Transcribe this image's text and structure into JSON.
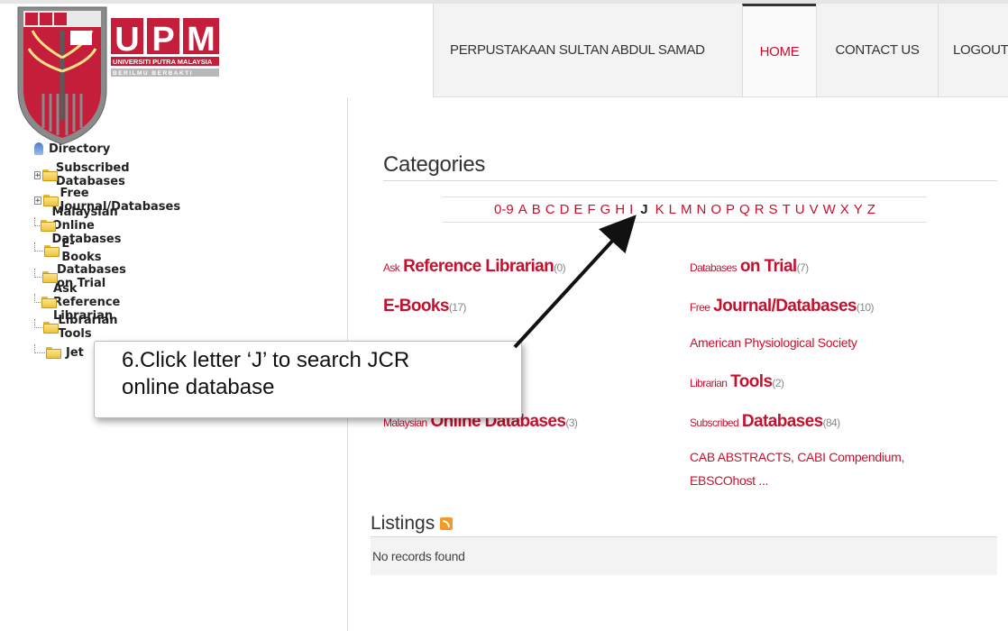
{
  "header": {
    "logo": {
      "letters": "UPM",
      "university": "UNIVERSITI PUTRA MALAYSIA",
      "motto": "BERILMU BERBAKTI"
    },
    "nav": [
      {
        "label": "PERPUSTAKAAN SULTAN ABDUL SAMAD",
        "active": false
      },
      {
        "label": "HOME",
        "active": true
      },
      {
        "label": "CONTACT US",
        "active": false
      },
      {
        "label": "LOGOUT",
        "active": false
      }
    ]
  },
  "sidebar": {
    "root": "Directory",
    "items": [
      {
        "label": "Subscribed Databases",
        "expandable": true
      },
      {
        "label": "Free Journal/Databases",
        "expandable": true
      },
      {
        "label": "Malaysian Online Databases",
        "expandable": false
      },
      {
        "label": "E-Books",
        "expandable": false
      },
      {
        "label": "Databases on Trial",
        "expandable": false
      },
      {
        "label": "Ask Reference Librarian",
        "expandable": false
      },
      {
        "label": "Librarian Tools",
        "expandable": false
      },
      {
        "label": "Jet",
        "expandable": false
      }
    ]
  },
  "main": {
    "categories_title": "Categories",
    "alphabet": [
      "0-9",
      "A",
      "B",
      "C",
      "D",
      "E",
      "F",
      "G",
      "H",
      "I",
      "J",
      "K",
      "L",
      "M",
      "N",
      "O",
      "P",
      "Q",
      "R",
      "S",
      "T",
      "U",
      "V",
      "W",
      "X",
      "Y",
      "Z"
    ],
    "active_letter": "J",
    "categories": {
      "ask": {
        "small": "Ask",
        "big": "Reference Librarian",
        "count": "(0)"
      },
      "ebooks": {
        "big": "E-Books",
        "count": "(17)"
      },
      "malaysian": {
        "small": "Malaysian",
        "big": "Online Databases",
        "count": "(3)"
      },
      "trial": {
        "small": "Databases",
        "big": "on Trial",
        "count": "(7)"
      },
      "free": {
        "small": "Free",
        "big": "Journal/Databases",
        "count": "(10)"
      },
      "free_sub": "American Physiological Society",
      "tools": {
        "small": "Librarian",
        "big": "Tools",
        "count": "(2)"
      },
      "subscribed": {
        "small": "Subscribed",
        "big": "Databases",
        "count": "(84)"
      },
      "subscribed_sub_1": "CAB ABSTRACTS, CABI Compendium,",
      "subscribed_sub_2": "EBSCOhost ..."
    },
    "listings_title": "Listings",
    "listings_empty": "No records found"
  },
  "callout": {
    "line1": "6.Click letter ‘J’ to search JCR",
    "line2": "online database"
  },
  "colors": {
    "accent": "#c8102e",
    "nav_bg": "#f3f3f3"
  }
}
